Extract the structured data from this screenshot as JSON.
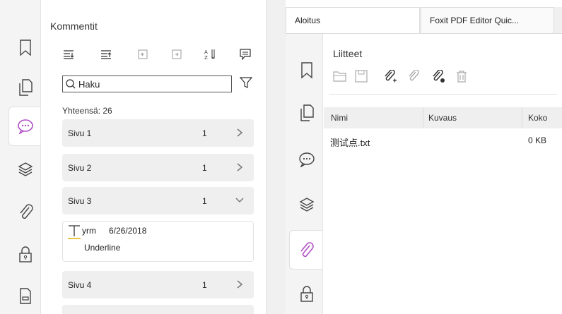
{
  "comments_panel": {
    "title": "Kommentit",
    "search": {
      "value": "Haku"
    },
    "total": "Yhteensä: 26",
    "pages": [
      {
        "label": "Sivu 1",
        "count": "1",
        "expanded": false
      },
      {
        "label": "Sivu 2",
        "count": "1",
        "expanded": false
      },
      {
        "label": "Sivu 3",
        "count": "1",
        "expanded": true
      },
      {
        "label": "Sivu 4",
        "count": "1",
        "expanded": false
      }
    ],
    "comment": {
      "author": "yrm",
      "date": "6/26/2018",
      "text": "Underline"
    },
    "toolbar_icons": [
      "expand-all-icon",
      "collapse-all-icon",
      "previous-icon",
      "next-icon",
      "sort-icon",
      "comment-icon"
    ]
  },
  "tabs": [
    {
      "label": "Aloitus",
      "active": true
    },
    {
      "label": "Foxit PDF Editor Quic...",
      "active": false
    }
  ],
  "attachments_panel": {
    "title": "Liitteet",
    "toolbar_icons": [
      "open-icon",
      "save-icon",
      "add-attachment-icon",
      "attachment-icon",
      "attachment-settings-icon",
      "delete-icon"
    ],
    "columns": [
      "Nimi",
      "Kuvaus",
      "Koko"
    ],
    "rows": [
      {
        "name": "测试点.txt",
        "description": "",
        "size": "0 KB"
      }
    ]
  },
  "colors": {
    "accent": "#b14fc5",
    "underline": "#e0b000"
  }
}
